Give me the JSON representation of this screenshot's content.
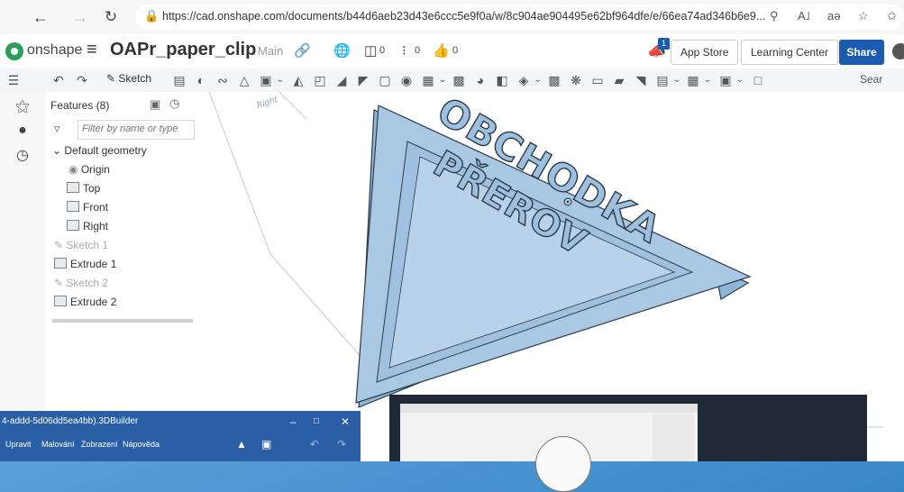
{
  "browser": {
    "url": "https://cad.onshape.com/documents/b44d6aeb23d43e6ccc5e9f0a/w/8c904ae904495e62bf964dfe/e/66ea74ad346b6e9...",
    "zoom_icon": "A˩",
    "reader_label": "aə"
  },
  "header": {
    "brand": "onshape",
    "document_name": "OAPr_paper_clip",
    "branch": "Main",
    "versions_count": "0",
    "branch_count": "0",
    "likes_count": "0",
    "notification_count": "1",
    "app_store": "App Store",
    "learning_center": "Learning Center",
    "share": "Share"
  },
  "toolbar": {
    "sketch_label": "Sketch",
    "search_label": "Sear"
  },
  "features": {
    "title": "Features (8)",
    "filter_placeholder": "Filter by name or type",
    "items": [
      {
        "label": "Default geometry"
      },
      {
        "label": "Origin"
      },
      {
        "label": "Top"
      },
      {
        "label": "Front"
      },
      {
        "label": "Right"
      },
      {
        "label": "Sketch 1"
      },
      {
        "label": "Extrude 1"
      },
      {
        "label": "Sketch 2"
      },
      {
        "label": "Extrude 2"
      }
    ]
  },
  "model": {
    "text_line1": "OBCHODKA",
    "text_line2": "PŘEROV",
    "plane_label": "Right"
  },
  "builder": {
    "title": "4-addd-5d06dd5ea4bb).3DBuilder",
    "menu": [
      "Upravit",
      "Malování",
      "Zobrazení",
      "Nápověda"
    ]
  },
  "colors": {
    "accent": "#1c5cb0",
    "model_fill": "#a9c8e4",
    "model_edge": "#2e3a45",
    "desktop": "#3b86c9"
  }
}
